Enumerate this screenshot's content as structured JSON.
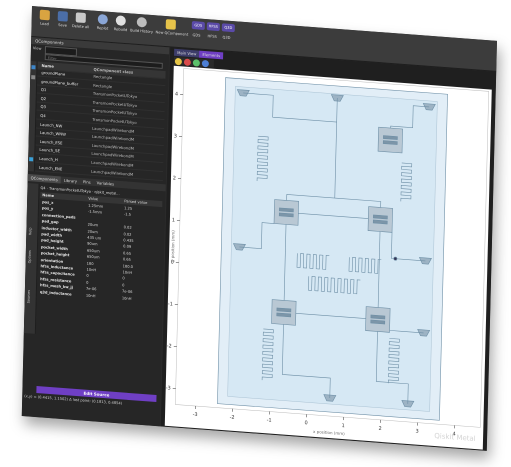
{
  "toolbar": {
    "buttons": [
      {
        "label": "Load",
        "icon": "folder-icon"
      },
      {
        "label": "Save",
        "icon": "save-icon"
      },
      {
        "label": "Delete all",
        "icon": "delete-icon"
      },
      {
        "label": "Replot",
        "icon": "replot-icon"
      },
      {
        "label": "Rebuild",
        "icon": "rebuild-icon"
      },
      {
        "label": "Build History",
        "icon": "history-icon"
      },
      {
        "label": "New QComponent",
        "icon": "new-component-icon"
      }
    ],
    "renderers": [
      "GDS",
      "HFSS",
      "Q3D"
    ]
  },
  "left_panel": {
    "title": "QComponents",
    "view_label": "View",
    "filter_placeholder": "Filter",
    "columns": [
      "Name",
      "QComponent class"
    ],
    "rows": [
      [
        "groundPlane",
        "Rectangle"
      ],
      [
        "groundPlane_buffer",
        "Rectangle"
      ],
      [
        "Q1",
        "TransmonPocketUTokyo"
      ],
      [
        "Q2",
        "TransmonPocketUTokyo"
      ],
      [
        "Q3",
        "TransmonPocketUTokyo"
      ],
      [
        "Q4",
        "TransmonPocketUTokyo"
      ],
      [
        "Launch_NW",
        "LaunchpadWirebondM"
      ],
      [
        "Launch_WNW",
        "LaunchpadWirebondM"
      ],
      [
        "Launch_ESE",
        "LaunchpadWirebondM"
      ],
      [
        "Launch_SE",
        "LaunchpadWirebondM"
      ],
      [
        "Launch_H",
        "LaunchpadWirebondM"
      ],
      [
        "Launch_ENE",
        "LaunchpadWirebondM"
      ]
    ],
    "bottom_tabs": [
      "QComponents",
      "Library",
      "Pins",
      "Variables"
    ],
    "side_tabs": [
      "Help",
      "Options",
      "Sources"
    ],
    "component_path": [
      "Q4",
      "TransmonPocketUTokyo",
      "qiskit_metal..."
    ],
    "prop_columns": [
      "Name",
      "Value",
      "Parsed value"
    ],
    "props": [
      [
        "pos_x",
        "1.25mm",
        "1.25"
      ],
      [
        "pos_y",
        "-1.5mm",
        "-1.5"
      ],
      [
        "connection_pads",
        "",
        ""
      ],
      [
        "pad_gap",
        "20um",
        "0.02"
      ],
      [
        "inductor_width",
        "20um",
        "0.02"
      ],
      [
        "pad_width",
        "435 um",
        "0.435"
      ],
      [
        "pad_height",
        "90um",
        "0.09"
      ],
      [
        "pocket_width",
        "650um",
        "0.65"
      ],
      [
        "pocket_height",
        "650um",
        "0.65"
      ],
      [
        "orientation",
        "180",
        "180.0"
      ],
      [
        "hfss_inductance",
        "10nH",
        "10nH"
      ],
      [
        "hfss_capacitance",
        "0",
        "0"
      ],
      [
        "hfss_resistance",
        "0",
        "0"
      ],
      [
        "hfss_mesh_kw_jj",
        "7e-06",
        "7e-06"
      ],
      [
        "q3d_inductance",
        "10nH",
        "10nH"
      ]
    ],
    "edit_button": "Edit Source",
    "status": "(x,y) = (0.4415, 1.1502)  Δ last point: (0.1813, 0.4854)"
  },
  "right_panel": {
    "tabs": [
      "Main View",
      "Elements"
    ],
    "axis_x_ticks": [
      "-3",
      "-2",
      "-1",
      "0",
      "1",
      "2",
      "3",
      "4"
    ],
    "axis_y_ticks": [
      "4",
      "3",
      "2",
      "1",
      "0",
      "-1",
      "-2",
      "-3"
    ],
    "x_axis_label": "x position (mm)",
    "y_axis_label": "y position (mm)",
    "watermark": "Qiskit Metal"
  },
  "colors": {
    "accent": "#6f3fc4",
    "flag": "#5a4aa8",
    "chip_fill": "#d6e8f4",
    "chip_edge": "#6e8fa6",
    "qubit_fill": "#b9c8d4"
  }
}
